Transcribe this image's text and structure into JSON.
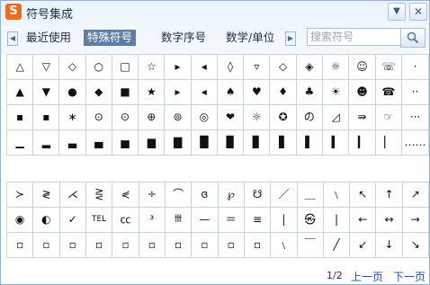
{
  "window": {
    "title": "符号集成",
    "logo_char": "S",
    "minimize_glyph": "▼",
    "close_glyph": "✕"
  },
  "tabs": [
    {
      "label": "最近使用"
    },
    {
      "label": "特殊符号",
      "active": true
    },
    {
      "label": "数字序号"
    },
    {
      "label": "数学/单位"
    }
  ],
  "search": {
    "placeholder": "搜索符号"
  },
  "grid1": [
    [
      "△",
      "▽",
      "◇",
      "○",
      "□",
      "☆",
      "▸",
      "◂",
      "◊",
      "▿",
      "◇",
      "◈",
      "☼",
      "☺",
      "☏",
      "·"
    ],
    [
      "▲",
      "▼",
      "●",
      "◆",
      "■",
      "★",
      "▸",
      "◂",
      "♠",
      "♥",
      "♦",
      "♣",
      "☀",
      "☻",
      "☎",
      "··"
    ],
    [
      "▪",
      "▪",
      "∗",
      "⊙",
      "⊙",
      "⊕",
      "⊚",
      "◎",
      "❤",
      "☼",
      "✪",
      "の",
      "◿",
      "⇛",
      "☞",
      "···"
    ],
    [
      "▁",
      "▂",
      "▃",
      "▄",
      "▅",
      "▆",
      "▇",
      "█",
      "▉",
      "▊",
      "▋",
      "▌",
      "▍",
      "▎",
      "▏",
      "……"
    ]
  ],
  "grid2": [
    [
      "≻",
      "≷",
      "⋌",
      "⋛",
      "⋞",
      "÷",
      "⌒",
      "ɞ",
      "℘",
      "☋",
      "／",
      "＿",
      "﹨",
      "↖",
      "↑",
      "↗"
    ],
    [
      "◉",
      "◐",
      "✓",
      "TEL",
      "㏄",
      "³",
      "卌",
      "—",
      "＝",
      "≡",
      "|",
      "㉿",
      "|",
      "←",
      "↔",
      "→"
    ],
    [
      "▫",
      "▫",
      "▫",
      "▫",
      "▫",
      "▫",
      "▫",
      "▫",
      "▫",
      "▫",
      "﹨",
      "￣",
      "╱",
      "↙",
      "↓",
      "↘"
    ]
  ],
  "footer": {
    "page_indicator": "1/2",
    "prev_label": "上一页",
    "next_label": "下一页"
  }
}
